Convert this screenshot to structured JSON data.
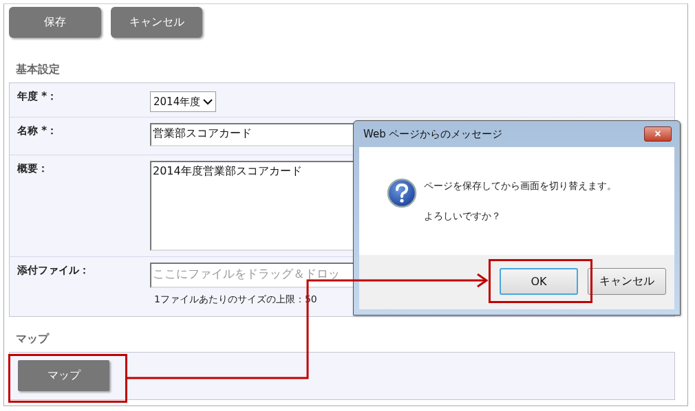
{
  "toolbar": {
    "buttons": [
      "保存",
      "キャンセル"
    ]
  },
  "basic_settings": {
    "heading": "基本設定",
    "year": {
      "label": "年度 *：",
      "value": "2014年度"
    },
    "name": {
      "label": "名称 *：",
      "value": "営業部スコアカード"
    },
    "summary": {
      "label": "概要：",
      "value": "2014年度営業部スコアカード"
    },
    "attachment": {
      "label": "添付ファイル：",
      "placeholder": "ここにファイルをドラッグ＆ドロッ",
      "hint": "1ファイルあたりのサイズの上限：50"
    }
  },
  "map_section": {
    "heading": "マップ",
    "button": "マップ"
  },
  "dialog": {
    "title": "Web ページからのメッセージ",
    "close": "×",
    "messages": [
      "ページを保存してから画面を切り替えます。",
      "よろしいですか？"
    ],
    "buttons": [
      {
        "label": "OK",
        "selected": true
      },
      {
        "label": "キャンセル",
        "selected": false
      }
    ]
  }
}
